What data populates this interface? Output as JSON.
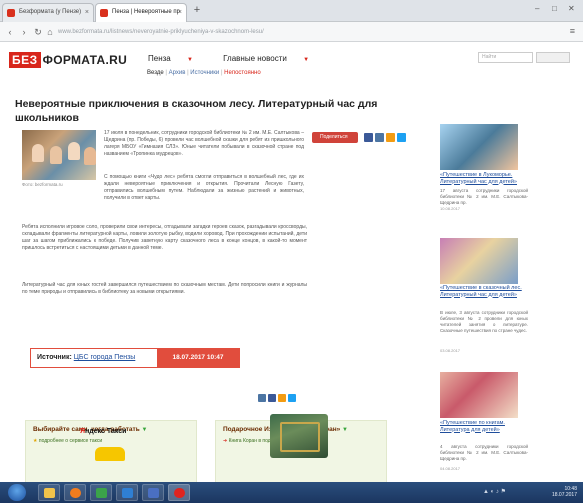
{
  "browser": {
    "tabs": [
      {
        "label": "Безформата (у Пензе)"
      },
      {
        "label": "Пенза | Невероятные пр"
      }
    ],
    "new_tab_label": "+",
    "url": "www.bezformata.ru/listnews/neveroyatnie-priklyucheniya-v-skazochnom-lesu/",
    "url_domain": "bezformata.ru"
  },
  "site": {
    "logo_prefix": "БЕЗ",
    "logo_rest": "ФОРМАТА.RU",
    "nav": [
      {
        "label": "Пенза"
      },
      {
        "label": "Главные новости"
      }
    ],
    "subnav": {
      "items": [
        "Везде",
        "Архив",
        "Источники",
        "Непостоянно"
      ]
    },
    "search_placeholder": "Найти"
  },
  "article": {
    "title": "Невероятные приключения в сказочном лесу. Литературный час для школьников",
    "photo_caption": "Фото: bezformata.ru",
    "paragraphs": [
      "17 июля в понедельник, сотрудники городской библиотеки № 2 им. М.Е. Салтыкова – Щедрина (пр. Победы, 6) провели час волшебной сказки для ребят из пришкольного лагеря МБОУ «Гимназия СЛЗ». Юные читатели побывали в сказочной стране под названием «Тропинка мудрецов».",
      "С помощью книги «Чудо лес» ребята смогли отправиться в волшебный лес, где их ждали невероятные приключения и открытия. Прочитали Лесную Газету, отправились волшебным путем. Наблюдали за жизнью растений и животных, получили в ответ карты.",
      "Ребята исполнили игровое соло, проверили свои интересы, отгадывали загадки героев сказок, разгадывали кроссворды, складывали фрагменты литературной карты, ловили золотую рыбку, водили хоровод. При прохождении испытаний, дети шаг за шагом приближались к победе. Получив заветную карту сказочного леса в конце концов, в какой-то момент пришлось встретиться с настоящими детьми в данной теме.",
      "Литературный час для юных гостей завершился путешествием по сказочным местам. Дети попросили книги и журналы по теме природы и отправились в библиотеку за новыми открытиями."
    ],
    "share_label": "Поделиться",
    "source_label": "Источник:",
    "source_name": "ЦБС города Пензы",
    "date": "18.07.2017  10:47"
  },
  "ads": [
    {
      "title": "Выбирайте сами, когда работать",
      "subtitle": "подробнее о сервисе такси",
      "brand_prefix": "Я",
      "brand_rest": "ндекс Такси"
    },
    {
      "title": "Подарочное Издание Книги «Коран»",
      "subtitle": "Книга Коран в подарочном"
    }
  ],
  "sidebar": [
    {
      "title": "«Путешествие в Лукоморье. Литературный час для детей»",
      "text": "17 августа сотрудники городской библиотеки № 2 им. М.Е. Салтыкова-Щедрина пр.",
      "date": "10.08.2017"
    },
    {
      "title": "«Путешествие в сказочный лес. Литературный час для детей»",
      "text": "В июле, 3 августа сотрудники городской библиотеки № 2 провели для юных читателей занятия о литературе. Сказочные путешествия по стране чудес.",
      "date": "03.08.2017"
    },
    {
      "title": "«Путешествие по книгам. Литература для детей»",
      "text": "4 августа сотрудники городской библиотеки № 2 им. М.Е. Салтыкова-Щедрина пр.",
      "date": "04.08.2017"
    }
  ],
  "taskbar": {
    "time": "10:48",
    "date": "18.07.2017"
  }
}
